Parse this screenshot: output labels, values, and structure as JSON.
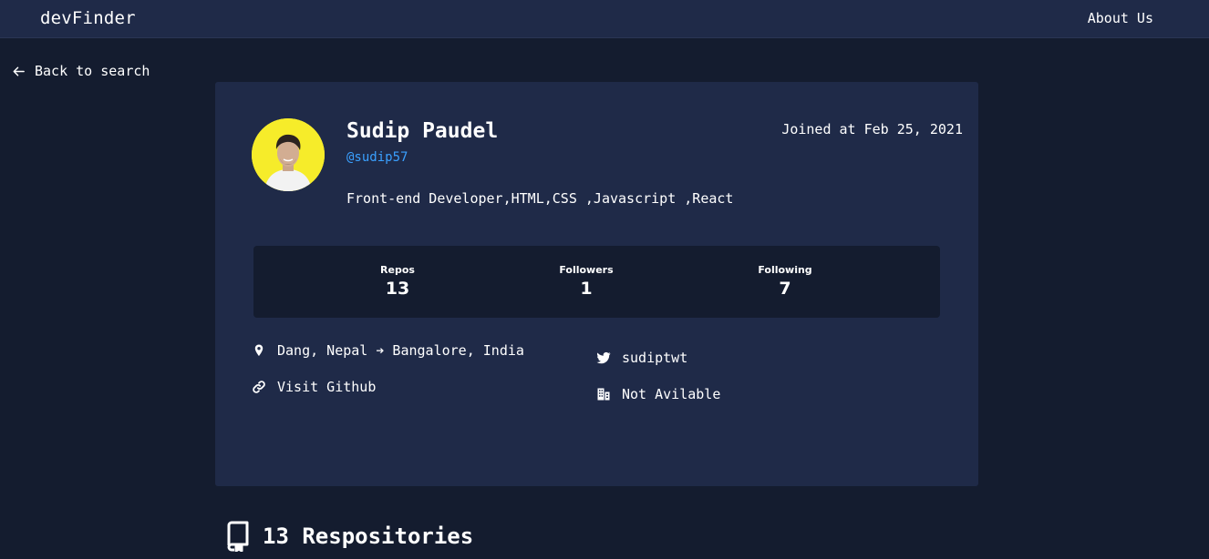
{
  "navbar": {
    "brand": "devFinder",
    "about_label": "About Us"
  },
  "back_link": {
    "label": "Back to search",
    "icon": "arrow-left-icon"
  },
  "profile": {
    "name": "Sudip Paudel",
    "handle": "@sudip57",
    "joined": "Joined at Feb 25, 2021",
    "bio": "Front-end Developer,HTML,CSS ,Javascript ,React",
    "avatar_bg": "#f6ec2a"
  },
  "stats": [
    {
      "label": "Repos",
      "value": "13"
    },
    {
      "label": "Followers",
      "value": "1"
    },
    {
      "label": "Following",
      "value": "7"
    }
  ],
  "links": {
    "location": {
      "text": "Dang, Nepal ➔ Bangalore, India",
      "icon": "location-pin-icon"
    },
    "website": {
      "text": "Visit Github",
      "icon": "link-icon"
    },
    "twitter": {
      "text": "sudiptwt",
      "icon": "twitter-icon"
    },
    "company": {
      "text": "Not Avilable",
      "icon": "building-icon"
    }
  },
  "repositories": {
    "title": "13 Respositories",
    "icon": "repo-book-icon"
  },
  "colors": {
    "background": "#141c2f",
    "card": "#1f2a48",
    "accent": "#3aa0ff"
  }
}
